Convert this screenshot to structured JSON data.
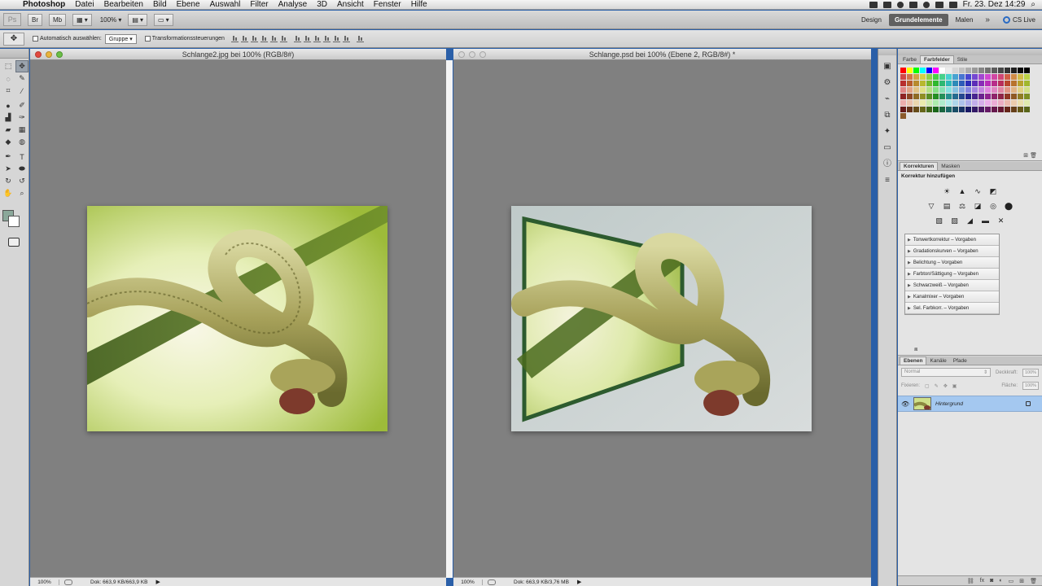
{
  "menubar": {
    "app_name": "Photoshop",
    "items": [
      "Datei",
      "Bearbeiten",
      "Bild",
      "Ebene",
      "Auswahl",
      "Filter",
      "Analyse",
      "3D",
      "Ansicht",
      "Fenster",
      "Hilfe"
    ],
    "clock": "Fr. 23. Dez  14:29"
  },
  "appbar": {
    "logo": "Ps",
    "br_label": "Br",
    "mb_label": "Mb",
    "zoom": "100%",
    "workspaces": [
      "Design",
      "Grundelemente",
      "Malen"
    ],
    "active_workspace": "Grundelemente",
    "more": "»",
    "cs_live": "CS Live"
  },
  "options": {
    "auto_select_label": "Automatisch auswählen:",
    "auto_select_value": "Gruppe",
    "transform_label": "Transformationssteuerungen"
  },
  "doc_left": {
    "title": "Schlange2.jpg bei 100% (RGB/8#)",
    "zoom": "100%",
    "info": "Dok: 663,9 KB/663,9 KB"
  },
  "doc_right": {
    "title": "Schlange.psd bei 100% (Ebene 2, RGB/8#) *",
    "zoom": "100%",
    "info": "Dok: 663,9 KB/3,76 MB"
  },
  "swatches_panel": {
    "tabs": [
      "Farbe",
      "Farbfelder",
      "Stile"
    ],
    "active_tab": "Farbfelder"
  },
  "corrections_panel": {
    "tabs": [
      "Korrekturen",
      "Masken"
    ],
    "title": "Korrektur hinzufügen",
    "presets": [
      "Tonwertkorrektur – Vorgaben",
      "Gradationskurven – Vorgaben",
      "Belichtung – Vorgaben",
      "Farbton/Sättigung – Vorgaben",
      "Schwarzweiß – Vorgaben",
      "Kanalmixer – Vorgaben",
      "Sel. Farbkorr. – Vorgaben"
    ]
  },
  "layers_panel": {
    "tabs": [
      "Ebenen",
      "Kanäle",
      "Pfade"
    ],
    "blend_mode": "Normal",
    "opacity_label": "Deckkraft:",
    "opacity_value": "100%",
    "lock_label": "Fixieren:",
    "fill_label": "Fläche:",
    "fill_value": "100%",
    "layers": [
      {
        "name": "Hintergrund",
        "selected": true
      }
    ]
  },
  "colors": {
    "accent": "#a4c8f0",
    "canvas_bg": "#808080",
    "workspace_active": "#606060"
  }
}
